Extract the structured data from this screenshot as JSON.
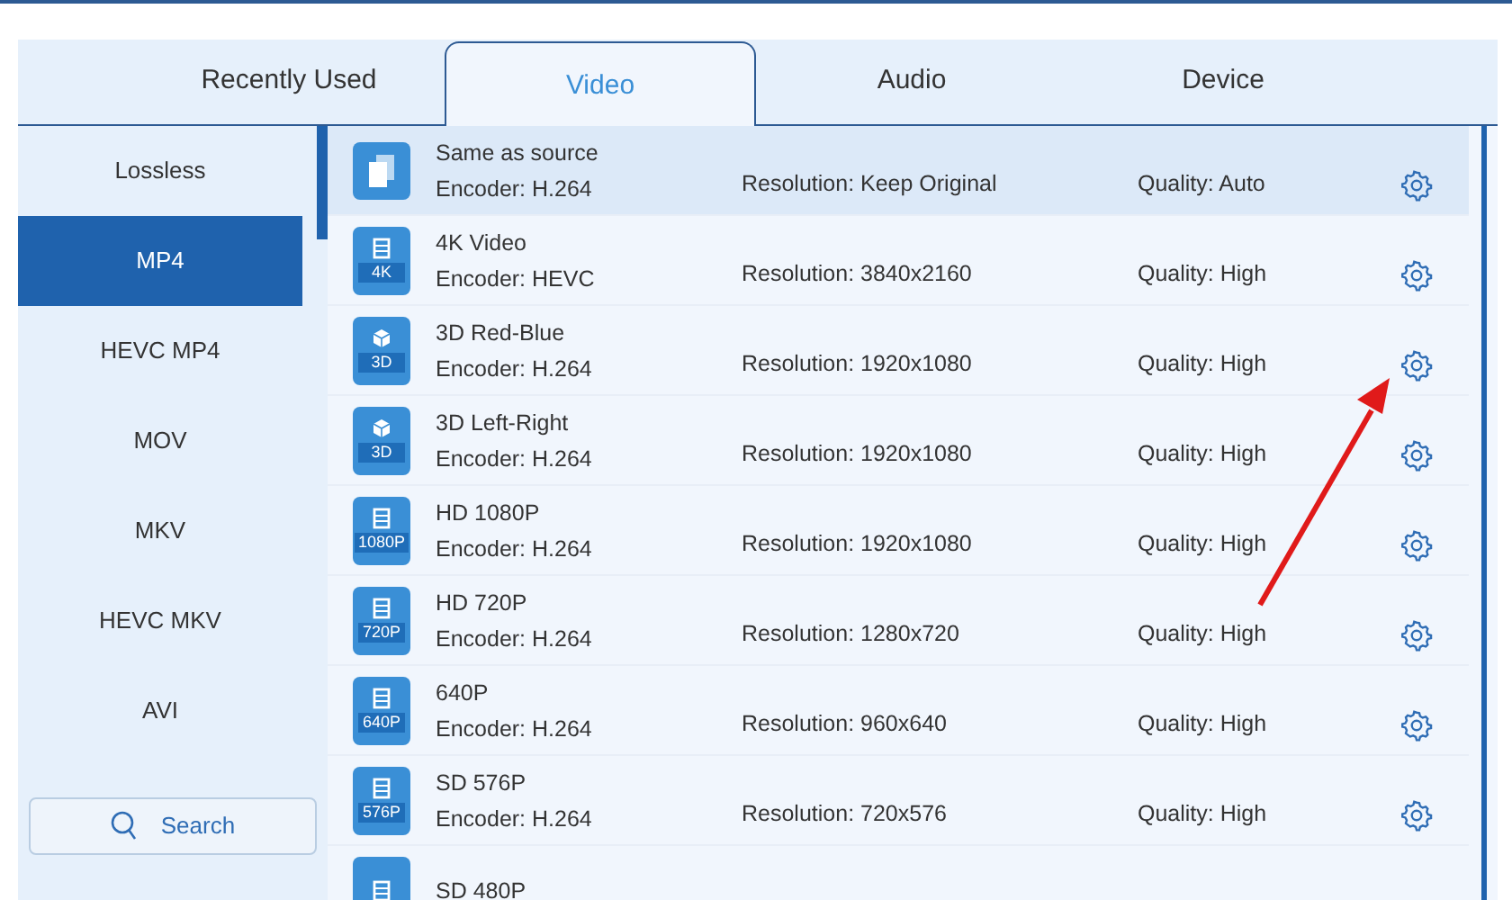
{
  "tabs": [
    {
      "label": "Recently Used",
      "selected": false
    },
    {
      "label": "Video",
      "selected": true
    },
    {
      "label": "Audio",
      "selected": false
    },
    {
      "label": "Device",
      "selected": false
    }
  ],
  "sidebar": {
    "items": [
      {
        "label": "Lossless",
        "selected": false
      },
      {
        "label": "MP4",
        "selected": true
      },
      {
        "label": "HEVC MP4",
        "selected": false
      },
      {
        "label": "MOV",
        "selected": false
      },
      {
        "label": "MKV",
        "selected": false
      },
      {
        "label": "HEVC MKV",
        "selected": false
      },
      {
        "label": "AVI",
        "selected": false
      }
    ],
    "search": {
      "label": "Search"
    }
  },
  "presets": [
    {
      "kind": "copy",
      "name": "Same as source",
      "encoder": "Encoder: H.264",
      "resolution": "Resolution: Keep Original",
      "quality": "Quality: Auto",
      "selected": true
    },
    {
      "kind": "film",
      "badge": "4K",
      "name": "4K Video",
      "encoder": "Encoder: HEVC",
      "resolution": "Resolution: 3840x2160",
      "quality": "Quality: High",
      "selected": false
    },
    {
      "kind": "cube",
      "badge": "3D",
      "name": "3D Red-Blue",
      "encoder": "Encoder: H.264",
      "resolution": "Resolution: 1920x1080",
      "quality": "Quality: High",
      "selected": false
    },
    {
      "kind": "cube",
      "badge": "3D",
      "name": "3D Left-Right",
      "encoder": "Encoder: H.264",
      "resolution": "Resolution: 1920x1080",
      "quality": "Quality: High",
      "selected": false
    },
    {
      "kind": "film",
      "badge": "1080P",
      "name": "HD 1080P",
      "encoder": "Encoder: H.264",
      "resolution": "Resolution: 1920x1080",
      "quality": "Quality: High",
      "selected": false
    },
    {
      "kind": "film",
      "badge": "720P",
      "name": "HD 720P",
      "encoder": "Encoder: H.264",
      "resolution": "Resolution: 1280x720",
      "quality": "Quality: High",
      "selected": false
    },
    {
      "kind": "film",
      "badge": "640P",
      "name": "640P",
      "encoder": "Encoder: H.264",
      "resolution": "Resolution: 960x640",
      "quality": "Quality: High",
      "selected": false
    },
    {
      "kind": "film",
      "badge": "576P",
      "name": "SD 576P",
      "encoder": "Encoder: H.264",
      "resolution": "Resolution: 720x576",
      "quality": "Quality: High",
      "selected": false
    },
    {
      "kind": "film",
      "name": "SD 480P",
      "selected": false
    }
  ]
}
